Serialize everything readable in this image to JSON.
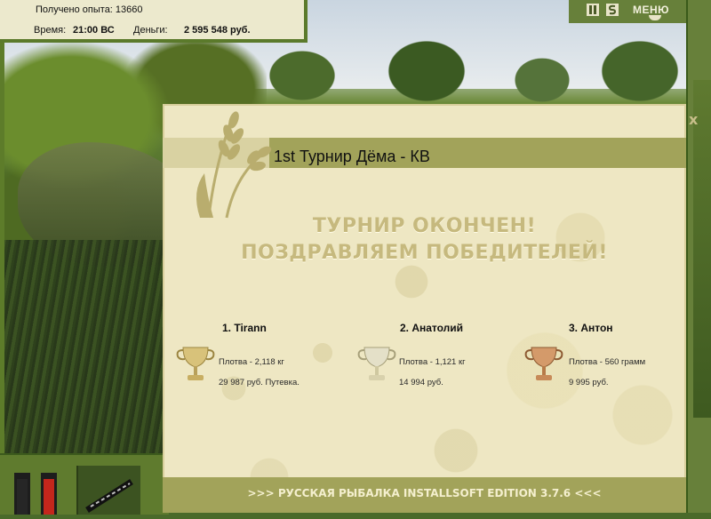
{
  "status": {
    "experience": "Получено опыта: 13660",
    "time_label": "Время:",
    "time_value": "21:00 ВС",
    "money_label": "Деньги:",
    "money_value": "2 595 548 руб."
  },
  "topbar": {
    "pause_icon": "pause-icon",
    "sound_icon": "sound-icon",
    "menu_label": "МЕНЮ"
  },
  "dialog": {
    "title": "1st Турнир Дёма - КВ",
    "close_label": "x",
    "headline_line1": "ТУРНИР ОКОНЧЕН!",
    "headline_line2": "ПОЗДРАВЛЯЕМ ПОБЕДИТЕЛЕЙ!",
    "winners": [
      {
        "name": "1. Tirann",
        "catch": "Плотва - 2,118 кг",
        "prize": "29 987 руб. Путевка.",
        "cup": "gold-cup-icon"
      },
      {
        "name": "2. Анатолий",
        "catch": "Плотва - 1,121 кг",
        "prize": "14 994 руб.",
        "cup": "silver-cup-icon"
      },
      {
        "name": "3. Антон",
        "catch": "Плотва - 560 грамм",
        "prize": "9 995 руб.",
        "cup": "bronze-cup-icon"
      }
    ],
    "footer": ">>> РУССКАЯ РЫБАЛКА INSTALLSOFT EDITION 3.7.6 <<<"
  },
  "colors": {
    "dialog_bg": "#eee7c3",
    "band": "#a2a35a",
    "headline": "#c6b97e",
    "frame": "#5f7b2e"
  }
}
